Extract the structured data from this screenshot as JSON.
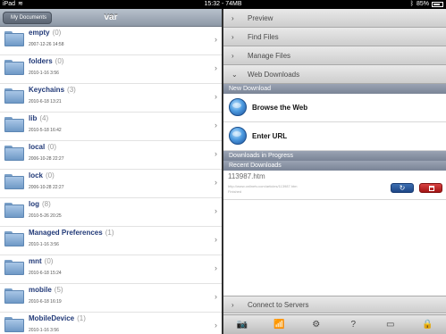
{
  "status_bar": {
    "device": "iPad",
    "wifi_icon": "wifi-icon",
    "time": "15:32",
    "memory": "74MB",
    "bluetooth_icon": "bluetooth-icon",
    "battery": "85%"
  },
  "left": {
    "back_button": "My Documents",
    "title": "var",
    "items": [
      {
        "name": "empty",
        "count": "(0)",
        "date": "2007-12-26 14:58"
      },
      {
        "name": "folders",
        "count": "(0)",
        "date": "2010-1-16 3:56"
      },
      {
        "name": "Keychains",
        "count": "(3)",
        "date": "2010-6-18 13:21"
      },
      {
        "name": "lib",
        "count": "(4)",
        "date": "2010-5-18 16:42"
      },
      {
        "name": "local",
        "count": "(0)",
        "date": "2006-10-28 22:27"
      },
      {
        "name": "lock",
        "count": "(0)",
        "date": "2006-10-28 22:27"
      },
      {
        "name": "log",
        "count": "(8)",
        "date": "2010-5-26 20:25"
      },
      {
        "name": "Managed Preferences",
        "count": "(1)",
        "date": "2010-1-16 3:56"
      },
      {
        "name": "mnt",
        "count": "(0)",
        "date": "2010-6-18 15:24"
      },
      {
        "name": "mobile",
        "count": "(5)",
        "date": "2010-6-18 16:19"
      },
      {
        "name": "MobileDevice",
        "count": "(1)",
        "date": "2010-1-16 3:56"
      }
    ]
  },
  "right": {
    "sections": [
      {
        "label": "Preview",
        "arrow": "›"
      },
      {
        "label": "Find Files",
        "arrow": "›"
      },
      {
        "label": "Manage Files",
        "arrow": "›"
      },
      {
        "label": "Web Downloads",
        "arrow": "⌄"
      }
    ],
    "new_download_header": "New Download",
    "actions": [
      {
        "label": "Browse the Web",
        "icon": "globe-icon"
      },
      {
        "label": "Enter URL",
        "icon": "globe-icon"
      }
    ],
    "in_progress_header": "Downloads in Progress",
    "recent_header": "Recent Downloads",
    "download": {
      "name": "113987.htm",
      "url": "http://www.onlinetv.com/articles/113987.htm",
      "status": "Finished"
    },
    "connect": {
      "label": "Connect to Servers",
      "arrow": "›"
    },
    "toolbar": {
      "camera": "📷",
      "wifi": "📶",
      "settings": "⚙",
      "help": "?",
      "display": "▭",
      "lock": "🔒"
    }
  }
}
